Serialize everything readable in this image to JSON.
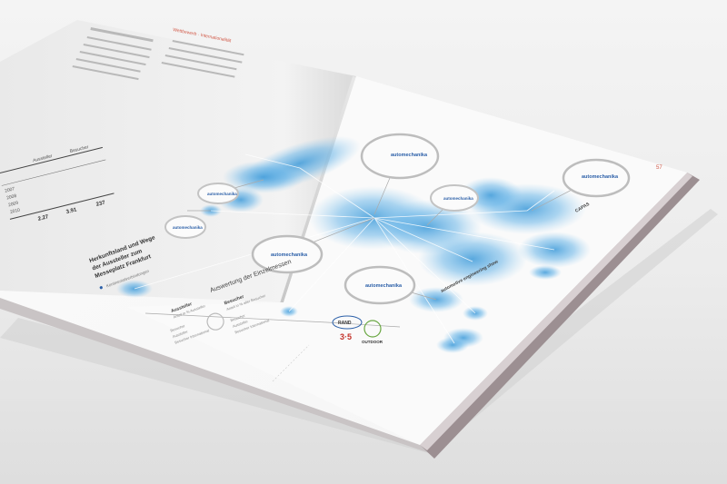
{
  "photo": {
    "subject": "open printed brochure with network map infographic",
    "accent_color": "#4aa3e0",
    "paper_color": "#fafafa"
  },
  "page_number": "57",
  "map_heading": [
    "Herkunftsland und Wege",
    "der Aussteller zum",
    "Messeplatz Frankfurt"
  ],
  "legend_note": "Kontinental­verbindungen",
  "section_title": "Auswertung der Einzelmessen",
  "legend": {
    "col1_title": "Aussteller",
    "col1_sub": "Anteil in % Aussteller",
    "col1_items": [
      "Besucher",
      "Aussteller",
      "Besucher International"
    ],
    "col2_title": "Besucher",
    "col2_sub": "Anteil in % aller Besucher",
    "col2_items": [
      "Besucher",
      "Aussteller",
      "Besucher International"
    ]
  },
  "bubbles": [
    {
      "brand": "automechanika"
    },
    {
      "brand": "automechanika"
    },
    {
      "brand": "automechanika"
    },
    {
      "brand": "automechanika"
    },
    {
      "brand": "automechanika"
    },
    {
      "brand": "automechanika"
    },
    {
      "brand": "automechanika"
    }
  ],
  "event_labels": [
    "CAPAS",
    "automotive engineering show"
  ],
  "logos": [
    "RAND",
    "3·5",
    "OUTDOOR"
  ],
  "left_page": {
    "header": "Wettbewerb · Internationalität",
    "table_cols": [
      "Aussteller",
      "Besucher"
    ],
    "table_rows": [
      "2007",
      "2008",
      "2009",
      "2010"
    ],
    "totals": [
      "2.27",
      "3.91",
      "237"
    ]
  }
}
